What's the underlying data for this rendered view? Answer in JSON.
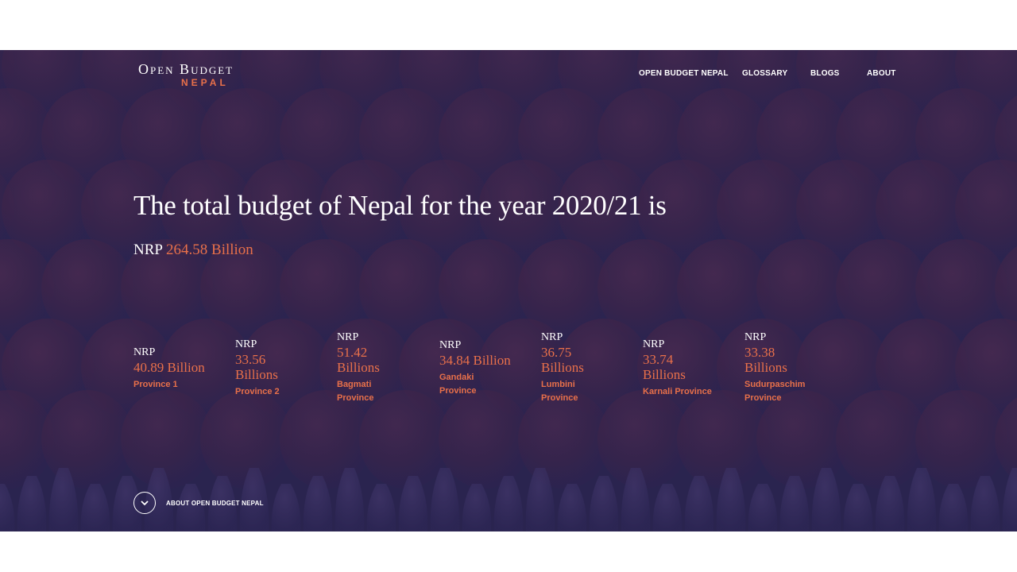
{
  "logo": {
    "line1": "Open Budget",
    "line2": "NEPAL"
  },
  "nav": {
    "items": [
      {
        "label": "OPEN BUDGET NEPAL"
      },
      {
        "label": "GLOSSARY"
      },
      {
        "label": "BLOGS"
      },
      {
        "label": "ABOUT"
      }
    ]
  },
  "hero": {
    "headline": "The total budget of Nepal for the year 2020/21 is",
    "total_prefix": "NRP",
    "total_amount": "264.58 Billion"
  },
  "provinces": [
    {
      "currency": "NRP",
      "value": "40.89 Billion",
      "name": "Province 1"
    },
    {
      "currency": "NRP",
      "value": "33.56 Billions",
      "name": "Province 2"
    },
    {
      "currency": "NRP",
      "value": "51.42 Billions",
      "name": "Bagmati Province"
    },
    {
      "currency": "NRP",
      "value": "34.84 Billion",
      "name": "Gandaki Province"
    },
    {
      "currency": "NRP",
      "value": "36.75 Billions",
      "name": "Lumbini Province"
    },
    {
      "currency": "NRP",
      "value": "33.74 Billions",
      "name": "Karnali Province"
    },
    {
      "currency": "NRP",
      "value": "33.38 Billions",
      "name": "Sudurpaschim Province"
    }
  ],
  "about_link": {
    "label": "ABOUT OPEN BUDGET NEPAL",
    "icon": "chevron-down-icon"
  },
  "colors": {
    "accent": "#e8704a",
    "background": "#2c2550",
    "text": "#ffffff"
  }
}
